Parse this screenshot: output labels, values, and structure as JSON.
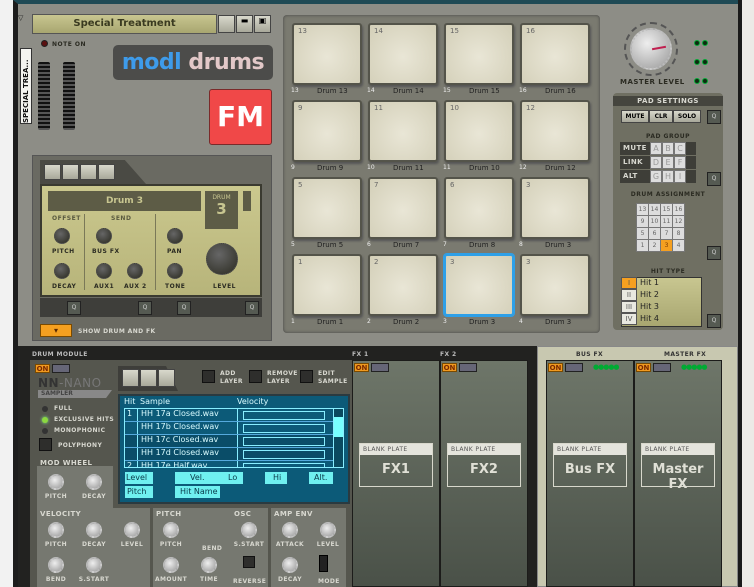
{
  "preset": {
    "name": "Special Treatment",
    "device_label": "SPECIAL TREA...",
    "note_on": "NOTE ON"
  },
  "logo": {
    "modl": "modl",
    "drums": "drums",
    "badge": "FM"
  },
  "drum_panel": {
    "name": "Drum 3",
    "drum_label": "DRUM",
    "drum_number": "3",
    "offset": "OFFSET",
    "send": "SEND",
    "knobs": {
      "pitch": "PITCH",
      "decay": "DECAY",
      "bus_fx": "BUS FX",
      "aux1": "AUX1",
      "aux2": "AUX 2",
      "pan": "PAN",
      "tone": "TONE",
      "level": "LEVEL"
    },
    "show_label": "SHOW DRUM AND FK",
    "q": "Q"
  },
  "pads": [
    {
      "num": "13",
      "idx": "13",
      "name": "Drum 13"
    },
    {
      "num": "14",
      "idx": "14",
      "name": "Drum 14"
    },
    {
      "num": "15",
      "idx": "15",
      "name": "Drum 15"
    },
    {
      "num": "16",
      "idx": "16",
      "name": "Drum 16"
    },
    {
      "num": "9",
      "idx": "9",
      "name": "Drum 9"
    },
    {
      "num": "11",
      "idx": "10",
      "name": "Drum 11"
    },
    {
      "num": "10",
      "idx": "11",
      "name": "Drum 10"
    },
    {
      "num": "12",
      "idx": "12",
      "name": "Drum 12"
    },
    {
      "num": "5",
      "idx": "5",
      "name": "Drum 5"
    },
    {
      "num": "7",
      "idx": "6",
      "name": "Drum 7"
    },
    {
      "num": "6",
      "idx": "7",
      "name": "Drum 8"
    },
    {
      "num": "3",
      "idx": "8",
      "name": "Drum 3"
    },
    {
      "num": "1",
      "idx": "1",
      "name": "Drum 1"
    },
    {
      "num": "2",
      "idx": "2",
      "name": "Drum 2"
    },
    {
      "num": "3",
      "idx": "3",
      "name": "Drum 3"
    },
    {
      "num": "3",
      "idx": "4",
      "name": "Drum 3"
    }
  ],
  "selected_pad": "3",
  "master": {
    "label": "MASTER LEVEL"
  },
  "pad_settings": {
    "title": "PAD SETTINGS",
    "mute": "MUTE",
    "clr": "CLR",
    "solo": "SOLO",
    "pad_group": "PAD GROUP",
    "rows": [
      {
        "label": "MUTE",
        "keys": [
          "A",
          "B",
          "C"
        ]
      },
      {
        "label": "LINK",
        "keys": [
          "D",
          "E",
          "F"
        ]
      },
      {
        "label": "ALT",
        "keys": [
          "G",
          "H",
          "I"
        ]
      }
    ],
    "drum_assignment": "DRUM ASSIGNMENT",
    "assign": [
      [
        "13",
        "14",
        "15",
        "16"
      ],
      [
        "9",
        "10",
        "11",
        "12"
      ],
      [
        "5",
        "6",
        "7",
        "8"
      ],
      [
        "1",
        "2",
        "3",
        "4"
      ]
    ],
    "assign_selected": "3",
    "hit_type": "HIT TYPE",
    "hits": [
      {
        "num": "I",
        "name": "Hit 1"
      },
      {
        "num": "II",
        "name": "Hit 2"
      },
      {
        "num": "III",
        "name": "Hit 3"
      },
      {
        "num": "IV",
        "name": "Hit 4"
      }
    ]
  },
  "module": {
    "title": "DRUM MODULE",
    "on": "ON",
    "name1": "NN",
    "name2": "-NANO",
    "sub": "SAMPLER",
    "add_layer": [
      "ADD",
      "LAYER"
    ],
    "remove_layer": [
      "REMOVE",
      "LAYER"
    ],
    "edit_sample": [
      "EDIT",
      "SAMPLE"
    ],
    "modes": [
      "FULL",
      "EXCLUSIVE HITS",
      "MONOPHONIC"
    ],
    "polyphony": "POLYPHONY",
    "table": {
      "headers": [
        "Hit",
        "Sample",
        "Velocity"
      ],
      "rows": [
        {
          "hit": "1",
          "sample": "HH 17a Closed.wav"
        },
        {
          "hit": "",
          "sample": "HH 17b Closed.wav"
        },
        {
          "hit": "",
          "sample": "HH 17c Closed.wav"
        },
        {
          "hit": "",
          "sample": "HH 17d Closed.wav"
        },
        {
          "hit": "2",
          "sample": "HH 17e Half.wav"
        }
      ],
      "level": "Level",
      "vel": "Vel.",
      "lo": "Lo",
      "hi": "Hi",
      "alt": "Alt.",
      "pitch": "Pitch",
      "hit_name": "Hit Name"
    },
    "mod_wheel": {
      "title": "MOD WHEEL",
      "pitch": "PITCH",
      "decay": "DECAY"
    },
    "velocity": {
      "title": "VELOCITY",
      "pitch": "PITCH",
      "decay": "DECAY",
      "level": "LEVEL",
      "bend": "BEND",
      "s_start": "S.START"
    },
    "pitch": {
      "title": "PITCH",
      "pitch": "PITCH",
      "bend": "BEND",
      "amount": "AMOUNT",
      "time": "TIME"
    },
    "osc": {
      "title": "OSC",
      "s_start": "S.START",
      "reverse": "REVERSE"
    },
    "amp_env": {
      "title": "AMP ENV",
      "attack": "ATTACK",
      "level": "LEVEL",
      "decay": "DECAY",
      "mode": "MODE"
    }
  },
  "fx": [
    {
      "title": "FX 1",
      "on": "ON",
      "plate": "BLANK PLATE",
      "name": "FX1"
    },
    {
      "title": "FX 2",
      "on": "ON",
      "plate": "BLANK PLATE",
      "name": "FX2"
    },
    {
      "title": "BUS FX",
      "on": "ON",
      "plate": "BLANK PLATE",
      "name": "Bus FX"
    },
    {
      "title": "MASTER FX",
      "on": "ON",
      "plate": "BLANK PLATE",
      "name": "Master FX"
    }
  ]
}
